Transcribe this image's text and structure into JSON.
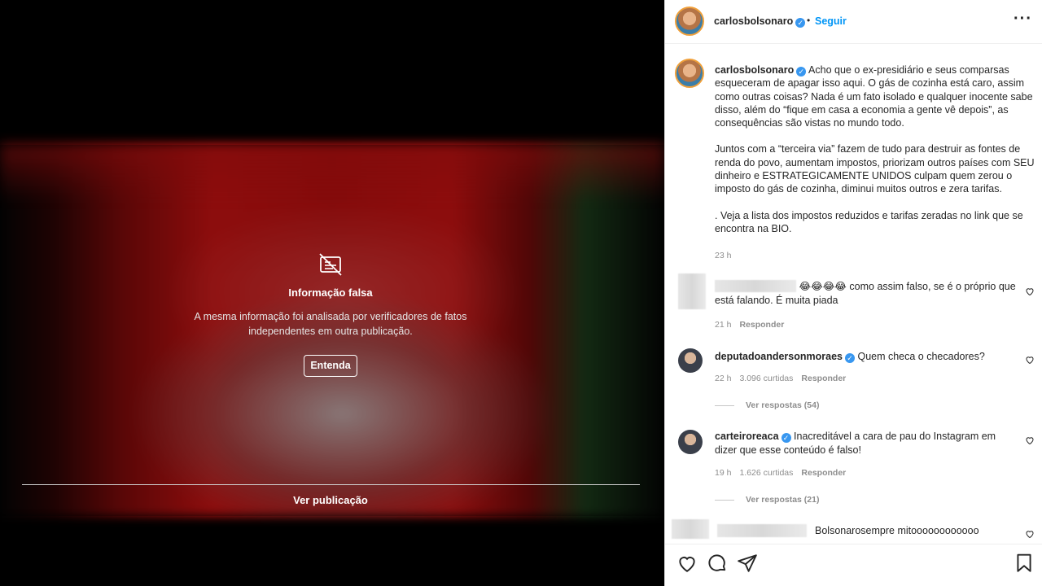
{
  "fact_check": {
    "title": "Informação falsa",
    "description": "A mesma informação foi analisada por verificadores de fatos independentes em outra publicação.",
    "learn_more": "Entenda",
    "see_post": "Ver publicação",
    "icon": "false-info-icon"
  },
  "post": {
    "username": "carlosbolsonaro",
    "follow_label": "Seguir",
    "dot": "•",
    "more_label": "···",
    "verified_mark": "✓",
    "caption_username": "carlosbolsonaro",
    "caption_p1": "Acho que o ex-presidiário e seus comparsas esqueceram de apagar isso aqui. O gás de cozinha está caro, assim como outras coisas? Nada é um fato isolado e qualquer inocente sabe disso, além do “fique em casa a economia a gente vê depois”, as consequências são vistas no mundo todo.",
    "caption_p2": "Juntos com a “terceira via” fazem de tudo para destruir as fontes de renda do povo, aumentam impostos, priorizam outros países com SEU dinheiro e ESTRATEGICAMENTE UNIDOS culpam quem zerou o imposto do gás de cozinha, diminui muitos outros e zera tarifas.",
    "caption_p3": ". Veja a lista dos impostos reduzidos e tarifas zeradas no link que se encontra na BIO.",
    "time": "23 h"
  },
  "comments": [
    {
      "username": "",
      "emojis": "😂😂😂😂",
      "text": "como assim falso, se é o próprio que está falando. É muita piada",
      "time": "21 h",
      "likes": "",
      "reply_label": "Responder"
    },
    {
      "username": "deputadoandersonmoraes",
      "text": "Quem checa o checadores?",
      "time": "22 h",
      "likes": "3.096 curtidas",
      "reply_label": "Responder",
      "view_replies": "Ver respostas (54)"
    },
    {
      "username": "carteiroreaca",
      "text": "Inacreditável a cara de pau do Instagram em dizer que esse conteúdo é falso!",
      "time": "19 h",
      "likes": "1.626 curtidas",
      "reply_label": "Responder",
      "view_replies": "Ver respostas (21)"
    },
    {
      "username": "",
      "text": "Bolsonarosempre mitoooooooooooo"
    }
  ],
  "actions": {
    "icons": [
      "heart-icon",
      "comment-icon",
      "share-icon",
      "bookmark-icon"
    ]
  },
  "colors": {
    "accent": "#0095f6",
    "verified": "#3897f0",
    "muted": "#8e8e8e"
  }
}
